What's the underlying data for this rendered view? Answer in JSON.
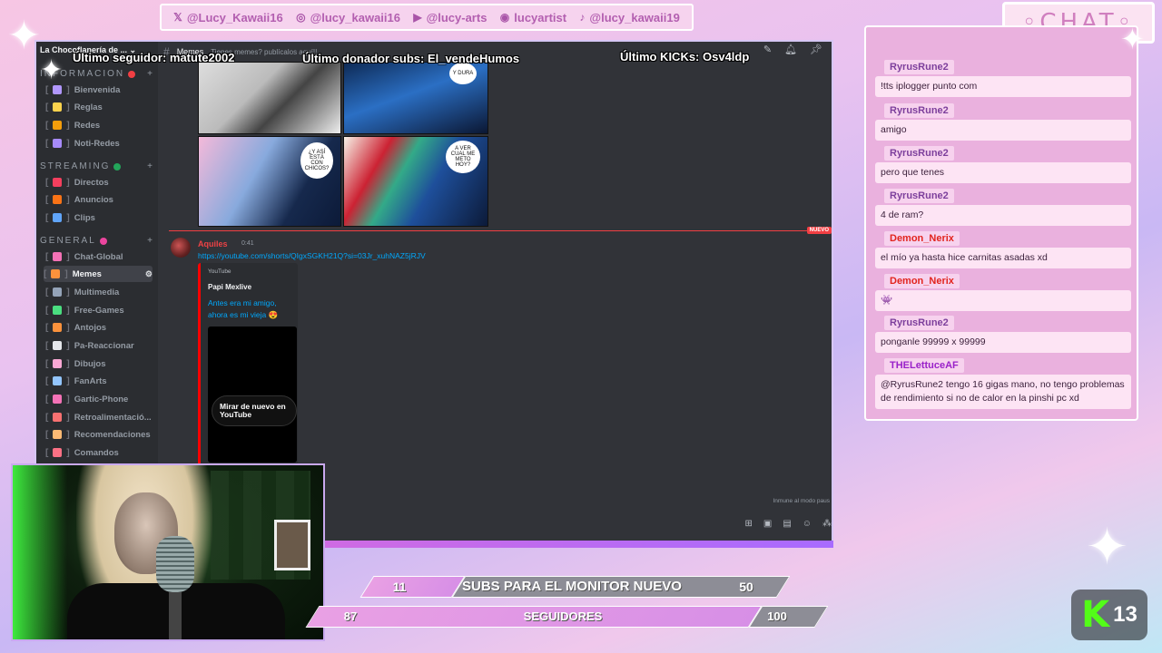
{
  "social": {
    "twitter": "@Lucy_Kawaii16",
    "instagram": "@lucy_kawaii16",
    "youtube": "@lucy-arts",
    "discord": "lucyartist",
    "tiktok": "@lucy_kawaii19"
  },
  "overlay": {
    "last_follower": "Último seguidor: matute2002",
    "last_donor": "Último donador subs: El_vendeHumos",
    "last_kicks": "Último KICKs: Osv4ldp"
  },
  "discord": {
    "server_name": "La Chocoflanería de ...",
    "channel_title": "Memes",
    "channel_topic": "Tienes memes? publícalos aquí!!",
    "categories": [
      {
        "label": "INFORMACION",
        "status_color": "#f23f43"
      },
      {
        "label": "STREAMING",
        "status_color": "#23a55a"
      },
      {
        "label": "GENERAL",
        "status_color": "#eb459e"
      }
    ],
    "channels_info": [
      {
        "label": "Bienvenida",
        "icon_color": "#b197fc"
      },
      {
        "label": "Reglas",
        "icon_color": "#fcd34d"
      },
      {
        "label": "Redes",
        "icon_color": "#f59e0b"
      },
      {
        "label": "Noti-Redes",
        "icon_color": "#a78bfa"
      }
    ],
    "channels_streaming": [
      {
        "label": "Directos",
        "icon_color": "#f43f5e"
      },
      {
        "label": "Anuncios",
        "icon_color": "#f97316"
      },
      {
        "label": "Clips",
        "icon_color": "#60a5fa"
      }
    ],
    "channels_general": [
      {
        "label": "Chat-Global",
        "icon_color": "#f472b6"
      },
      {
        "label": "Memes",
        "icon_color": "#fb923c"
      },
      {
        "label": "Multimedia",
        "icon_color": "#94a3b8"
      },
      {
        "label": "Free-Games",
        "icon_color": "#4ade80"
      },
      {
        "label": "Antojos",
        "icon_color": "#fb923c"
      },
      {
        "label": "Pa-Reaccionar",
        "icon_color": "#e5e7eb"
      },
      {
        "label": "Dibujos",
        "icon_color": "#f9a8d4"
      },
      {
        "label": "FanArts",
        "icon_color": "#93c5fd"
      },
      {
        "label": "Gartic-Phone",
        "icon_color": "#f472b6"
      },
      {
        "label": "Retroalimentació...",
        "icon_color": "#f87171"
      },
      {
        "label": "Recomendaciones",
        "icon_color": "#fdba74"
      },
      {
        "label": "Comandos",
        "icon_color": "#fb7185"
      }
    ],
    "meme_bubbles": {
      "b1": "Y DURA",
      "c1": "¿Y ASÍ ESTÁ CON CHICOS?",
      "d1": "A VER CUAL ME METO HOY?"
    },
    "new_badge": "NUEVO",
    "message": {
      "author": "Aquiles",
      "time": "0:41",
      "link": "https://youtube.com/shorts/QIgxSGKH21Q?si=03Jr_xuhNAZ5jRJV",
      "embed_provider": "YouTube",
      "embed_author": "Papi Mexlive",
      "embed_title": "Antes era mi amigo, ahora es mi vieja 😍",
      "rewatch_label": "Mirar de nuevo en YouTube"
    },
    "immune_text": "Inmune al modo paus"
  },
  "chat": {
    "header": "◦CHAT◦",
    "messages": [
      {
        "user": "RyrusRune2",
        "color": "default",
        "text": "!tts iplogger punto com"
      },
      {
        "user": "RyrusRune2",
        "color": "default",
        "text": "amigo"
      },
      {
        "user": "RyrusRune2",
        "color": "default",
        "text": "pero que tenes"
      },
      {
        "user": "RyrusRune2",
        "color": "default",
        "text": "4 de ram?"
      },
      {
        "user": "Demon_Nerix",
        "color": "red",
        "text": "el mío ya hasta hice carnitas asadas xd"
      },
      {
        "user": "Demon_Nerix",
        "color": "red",
        "text": "👾"
      },
      {
        "user": "RyrusRune2",
        "color": "default",
        "text": "ponganle 99999 x 99999"
      },
      {
        "user": "THELettuceAF",
        "color": "purple",
        "text": "@RyrusRune2 tengo 16 gigas mano, no tengo problemas de rendimiento si no de calor en la pinshi pc xd"
      }
    ]
  },
  "goals": {
    "subs": {
      "current": "11",
      "label": "SUBS PARA EL MONITOR NUEVO",
      "target": "50",
      "progress": 0.22
    },
    "followers": {
      "current": "87",
      "label": "SEGUIDORES",
      "target": "100",
      "progress": 0.87
    }
  },
  "kick_badge": {
    "letter": "K",
    "number": "13"
  }
}
